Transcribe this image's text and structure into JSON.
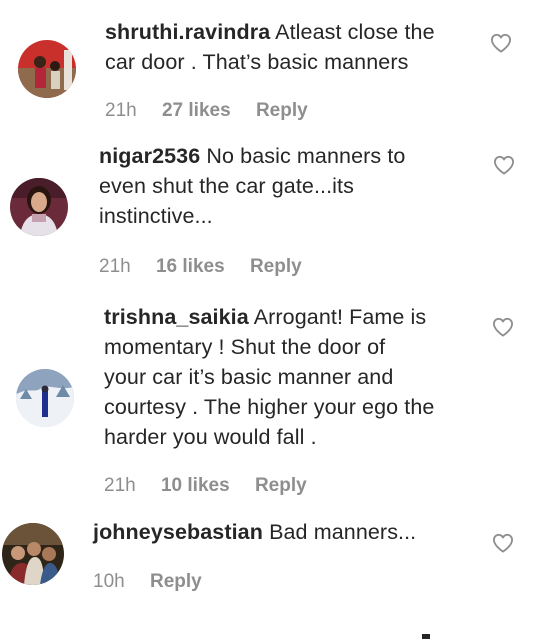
{
  "comments": [
    {
      "username": "shruthi.ravindra",
      "text_lines": [
        "Atleast close the",
        "car door . That’s basic manners"
      ],
      "time": "21h",
      "likes": "27 likes",
      "reply": "Reply",
      "avatar_icon": "avatar-photo-red"
    },
    {
      "username": "nigar2536",
      "text_lines": [
        "No basic manners to",
        "even shut the car gate...its",
        "instinctive..."
      ],
      "time": "21h",
      "likes": "16 likes",
      "reply": "Reply",
      "avatar_icon": "avatar-photo-woman"
    },
    {
      "username": "trishna_saikia",
      "text_lines": [
        "Arrogant! Fame is",
        "momentary ! Shut the door of",
        "your car it’s basic manner and",
        "courtesy . The higher your ego the",
        "harder you would fall ."
      ],
      "time": "21h",
      "likes": "10 likes",
      "reply": "Reply",
      "avatar_icon": "avatar-photo-snow"
    },
    {
      "username": "johneysebastian",
      "text_lines": [
        "Bad manners..."
      ],
      "time": "10h",
      "likes": "",
      "reply": "Reply",
      "avatar_icon": "avatar-photo-group"
    }
  ],
  "icons": {
    "like": "heart-outline-icon"
  },
  "colors": {
    "text": "#262626",
    "meta": "#8e8e8e",
    "heart_stroke": "#8e8e8e"
  }
}
